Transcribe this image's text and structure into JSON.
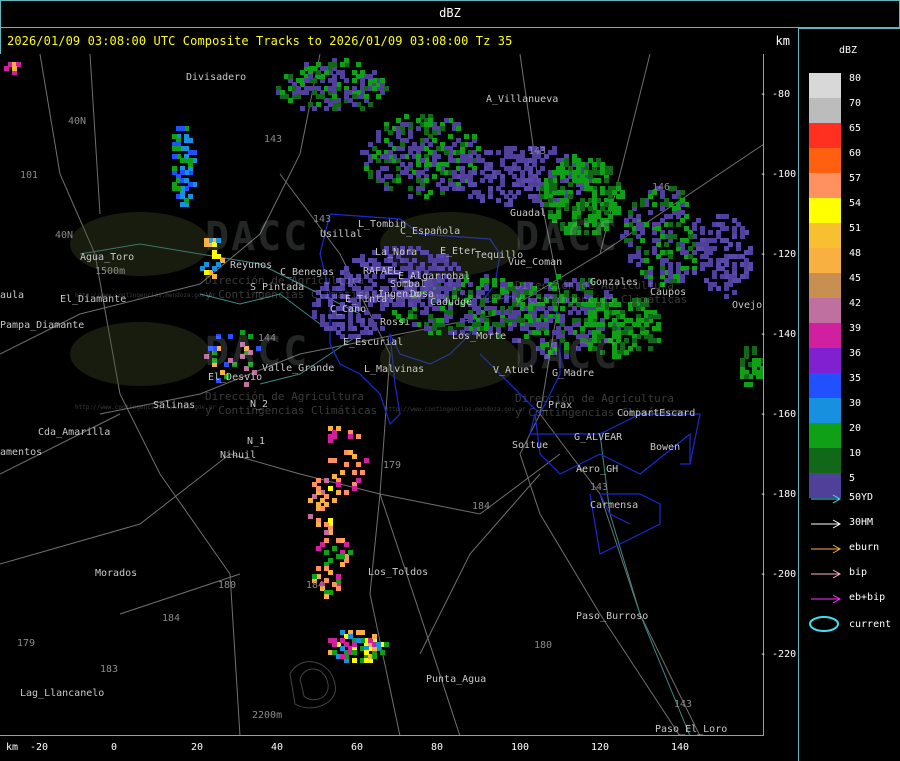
{
  "window": {
    "title": "dBZ"
  },
  "header": {
    "title": "2026/01/09 03:08:00 UTC Composite Tracks to 2026/01/09 03:08:00 Tz 35",
    "axis_unit": "km"
  },
  "legend": {
    "title": "dBZ",
    "scale": [
      {
        "value": "80",
        "color": "#d8d8d8"
      },
      {
        "value": "70",
        "color": "#bcbcbc"
      },
      {
        "value": "65",
        "color": "#ff3020"
      },
      {
        "value": "60",
        "color": "#ff6010"
      },
      {
        "value": "57",
        "color": "#ff9060"
      },
      {
        "value": "54",
        "color": "#ffff00"
      },
      {
        "value": "51",
        "color": "#f8c030"
      },
      {
        "value": "48",
        "color": "#f8b040"
      },
      {
        "value": "45",
        "color": "#c89050"
      },
      {
        "value": "42",
        "color": "#c070a0"
      },
      {
        "value": "39",
        "color": "#d020a0"
      },
      {
        "value": "36",
        "color": "#8020d0"
      },
      {
        "value": "35",
        "color": "#2050ff"
      },
      {
        "value": "30",
        "color": "#1890e0"
      },
      {
        "value": "20",
        "color": "#10a018"
      },
      {
        "value": "10",
        "color": "#106818"
      },
      {
        "value": "5",
        "color": "#50409a"
      }
    ],
    "tracks": [
      {
        "label": "50YD",
        "color": "#40e0f0"
      },
      {
        "label": "30HM",
        "color": "#ffffff"
      },
      {
        "label": "eburn",
        "color": "#f8b040"
      },
      {
        "label": "bip",
        "color": "#ffb0c0"
      },
      {
        "label": "eb+bip",
        "color": "#ff30ff"
      }
    ],
    "current_label": "current",
    "current_color": "#40e0f0"
  },
  "axes": {
    "unit": "km",
    "x_ticks": [
      "-20",
      "0",
      "20",
      "40",
      "60",
      "80",
      "100",
      "120",
      "140"
    ],
    "y_ticks": [
      "-80",
      "-100",
      "-120",
      "-140",
      "-160",
      "-180",
      "-200",
      "-220"
    ]
  },
  "places": [
    "Divisadero",
    "A_Villanueva",
    "Guadal",
    "Usillal",
    "L_Tombin",
    "C_Española",
    "E_Eter",
    "Tequillo",
    "Vue_Coman",
    "Agua_Toro",
    "Reyunos",
    "La_Nora",
    "E_Algarrobal",
    "S_Pintada",
    "C_Benegas",
    "RAFAEL",
    "Sombal",
    "C_Cano",
    "E_Tinta",
    "Ingenio",
    "Dosa",
    "Rossi",
    "Cadudge",
    "Los_Morte",
    "E_Escurial",
    "L_Malvinas",
    "V_Atuel",
    "G_Madre",
    "El_Desvio",
    "Valle_Grande",
    "Salinas",
    "N_2",
    "N_1",
    "Nihuil",
    "Cda_Amarilla",
    "amentos",
    "aula",
    "Pampa_Diamante",
    "El_Diamante",
    "Gonzales",
    "Caupos",
    "Ovejo",
    "C_Prax",
    "CompartEscard",
    "G_ALVEAR",
    "Soitue",
    "Bowen",
    "Aero_GH",
    "Carmensa",
    "Morados",
    "Los_Toldos",
    "Paso_Burroso",
    "Punta_Agua",
    "Lag_Llancanelo",
    "Paso_El_Loro"
  ],
  "roads": [
    "40N",
    "40N",
    "101",
    "143",
    "143",
    "144",
    "143",
    "146",
    "179",
    "184",
    "184",
    "180",
    "184",
    "183",
    "179",
    "180",
    "143",
    "143"
  ],
  "elevations": [
    "1500m",
    "2200m"
  ],
  "watermark": {
    "brand": "DACC",
    "line1": "Dirección de Agricultura",
    "line2": "y Contingencias Climáticas",
    "url": "http://www.contingencias.mendoza.gov.ar"
  }
}
